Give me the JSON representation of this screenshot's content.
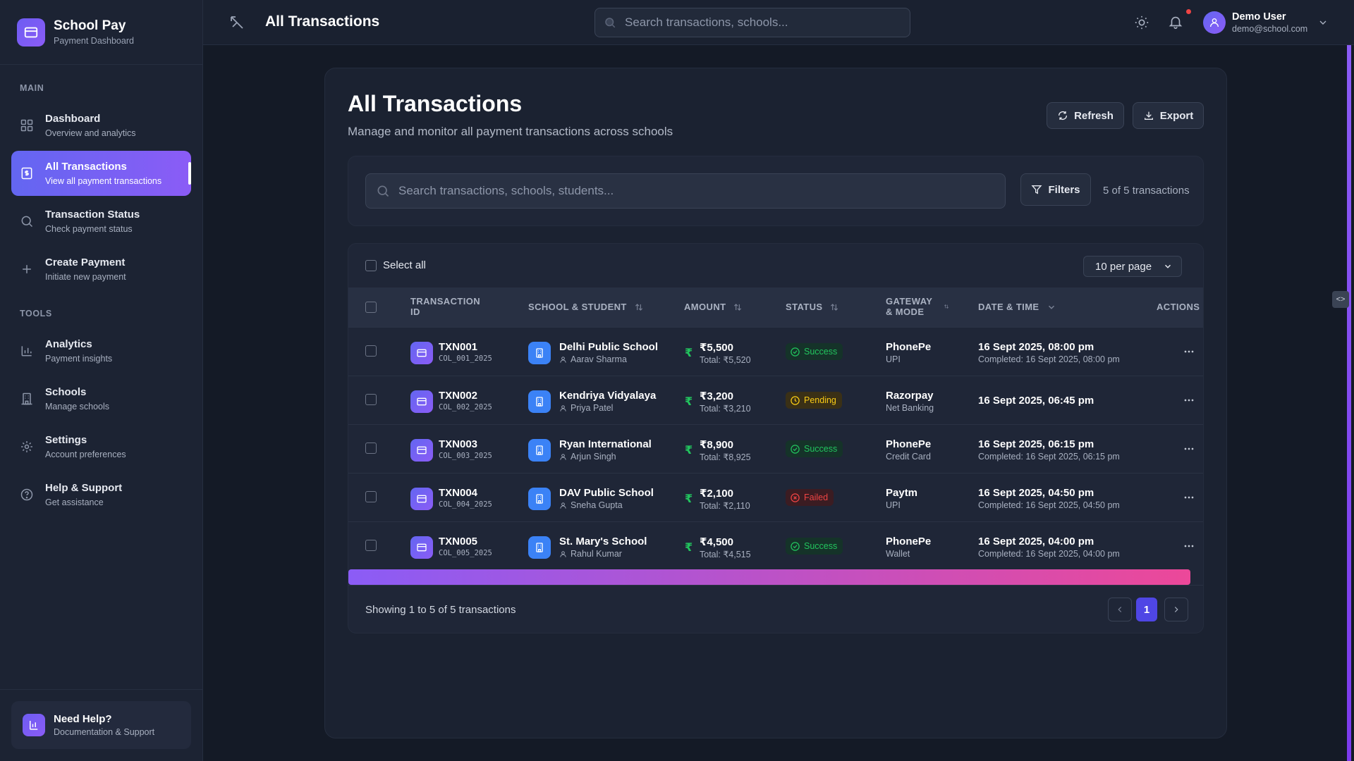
{
  "brand": {
    "name": "School Pay",
    "subtitle": "Payment Dashboard"
  },
  "sidebar": {
    "main_label": "MAIN",
    "tools_label": "TOOLS",
    "items": [
      {
        "label": "Dashboard",
        "desc": "Overview and analytics",
        "icon": "dashboard-grid-icon"
      },
      {
        "label": "All Transactions",
        "desc": "View all payment transactions",
        "icon": "receipt-icon",
        "active": true
      },
      {
        "label": "Transaction Status",
        "desc": "Check payment status",
        "icon": "search-icon"
      },
      {
        "label": "Create Payment",
        "desc": "Initiate new payment",
        "icon": "plus-icon"
      },
      {
        "label": "Analytics",
        "desc": "Payment insights",
        "icon": "bar-chart-icon"
      },
      {
        "label": "Schools",
        "desc": "Manage schools",
        "icon": "building-icon"
      },
      {
        "label": "Settings",
        "desc": "Account preferences",
        "icon": "gear-icon"
      },
      {
        "label": "Help & Support",
        "desc": "Get assistance",
        "icon": "help-circle-icon"
      }
    ],
    "help_card": {
      "title": "Need Help?",
      "subtitle": "Documentation & Support"
    }
  },
  "topbar": {
    "title": "All Transactions",
    "search_placeholder": "Search transactions, schools...",
    "user": {
      "name": "Demo User",
      "email": "demo@school.com"
    }
  },
  "page": {
    "title": "All Transactions",
    "subtitle": "Manage and monitor all payment transactions across schools",
    "refresh_label": "Refresh",
    "export_label": "Export",
    "search_placeholder": "Search transactions, schools, students...",
    "filters_label": "Filters",
    "count_text": "5 of 5 transactions",
    "select_all_label": "Select all",
    "per_page": "10 per page",
    "edge_handle": "<>"
  },
  "table": {
    "columns": {
      "txn": "TRANSACTION ID",
      "school": "SCHOOL & STUDENT",
      "amount": "AMOUNT",
      "status": "STATUS",
      "gateway": "GATEWAY & MODE",
      "date": "DATE & TIME",
      "actions": "ACTIONS"
    },
    "rows": [
      {
        "id": "TXN001",
        "collect_id": "COL_001_2025",
        "school": "Delhi Public School",
        "student": "Aarav Sharma",
        "amount": "₹5,500",
        "total": "Total: ₹5,520",
        "status": "Success",
        "status_kind": "success",
        "gateway": "PhonePe",
        "mode": "UPI",
        "datetime": "16 Sept 2025, 08:00 pm",
        "completed": "Completed: 16 Sept 2025, 08:00 pm"
      },
      {
        "id": "TXN002",
        "collect_id": "COL_002_2025",
        "school": "Kendriya Vidyalaya",
        "student": "Priya Patel",
        "amount": "₹3,200",
        "total": "Total: ₹3,210",
        "status": "Pending",
        "status_kind": "pending",
        "gateway": "Razorpay",
        "mode": "Net Banking",
        "datetime": "16 Sept 2025, 06:45 pm",
        "completed": ""
      },
      {
        "id": "TXN003",
        "collect_id": "COL_003_2025",
        "school": "Ryan International",
        "student": "Arjun Singh",
        "amount": "₹8,900",
        "total": "Total: ₹8,925",
        "status": "Success",
        "status_kind": "success",
        "gateway": "PhonePe",
        "mode": "Credit Card",
        "datetime": "16 Sept 2025, 06:15 pm",
        "completed": "Completed: 16 Sept 2025, 06:15 pm"
      },
      {
        "id": "TXN004",
        "collect_id": "COL_004_2025",
        "school": "DAV Public School",
        "student": "Sneha Gupta",
        "amount": "₹2,100",
        "total": "Total: ₹2,110",
        "status": "Failed",
        "status_kind": "failed",
        "gateway": "Paytm",
        "mode": "UPI",
        "datetime": "16 Sept 2025, 04:50 pm",
        "completed": "Completed: 16 Sept 2025, 04:50 pm"
      },
      {
        "id": "TXN005",
        "collect_id": "COL_005_2025",
        "school": "St. Mary's School",
        "student": "Rahul Kumar",
        "amount": "₹4,500",
        "total": "Total: ₹4,515",
        "status": "Success",
        "status_kind": "success",
        "gateway": "PhonePe",
        "mode": "Wallet",
        "datetime": "16 Sept 2025, 04:00 pm",
        "completed": "Completed: 16 Sept 2025, 04:00 pm"
      }
    ]
  },
  "pagination": {
    "showing_text": "Showing 1 to 5 of 5 transactions",
    "current_page": "1"
  },
  "colors": {
    "accent": "#6366f1",
    "accent_purple": "#8b5cf6",
    "success": "#22c55e",
    "pending": "#facc15",
    "failed": "#ef4444",
    "school_icon": "#3b82f6"
  }
}
